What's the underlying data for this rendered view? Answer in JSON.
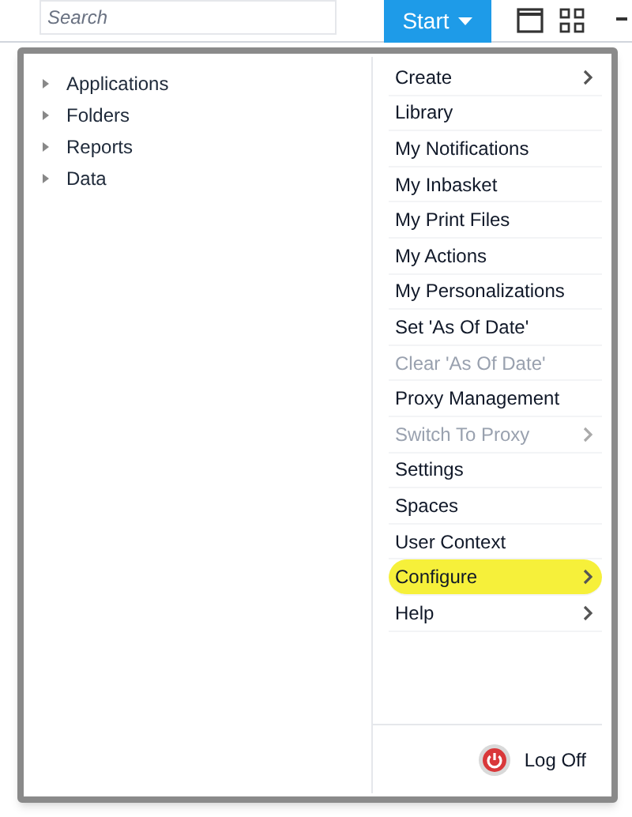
{
  "search": {
    "placeholder": "Search"
  },
  "start_button": {
    "label": "Start"
  },
  "tree": [
    {
      "label": "Applications"
    },
    {
      "label": "Folders"
    },
    {
      "label": "Reports"
    },
    {
      "label": "Data"
    }
  ],
  "menu": [
    {
      "label": "Create",
      "submenu": true,
      "disabled": false,
      "highlighted": false
    },
    {
      "label": "Library",
      "submenu": false,
      "disabled": false,
      "highlighted": false
    },
    {
      "label": "My Notifications",
      "submenu": false,
      "disabled": false,
      "highlighted": false
    },
    {
      "label": "My Inbasket",
      "submenu": false,
      "disabled": false,
      "highlighted": false
    },
    {
      "label": "My Print Files",
      "submenu": false,
      "disabled": false,
      "highlighted": false
    },
    {
      "label": "My Actions",
      "submenu": false,
      "disabled": false,
      "highlighted": false
    },
    {
      "label": "My Personalizations",
      "submenu": false,
      "disabled": false,
      "highlighted": false
    },
    {
      "label": "Set 'As Of Date'",
      "submenu": false,
      "disabled": false,
      "highlighted": false
    },
    {
      "label": "Clear 'As Of Date'",
      "submenu": false,
      "disabled": true,
      "highlighted": false
    },
    {
      "label": "Proxy Management",
      "submenu": false,
      "disabled": false,
      "highlighted": false
    },
    {
      "label": "Switch To Proxy",
      "submenu": true,
      "disabled": true,
      "highlighted": false
    },
    {
      "label": "Settings",
      "submenu": false,
      "disabled": false,
      "highlighted": false
    },
    {
      "label": "Spaces",
      "submenu": false,
      "disabled": false,
      "highlighted": false
    },
    {
      "label": "User Context",
      "submenu": false,
      "disabled": false,
      "highlighted": false
    },
    {
      "label": "Configure",
      "submenu": true,
      "disabled": false,
      "highlighted": true
    },
    {
      "label": "Help",
      "submenu": true,
      "disabled": false,
      "highlighted": false
    }
  ],
  "log_off": {
    "label": "Log Off"
  }
}
